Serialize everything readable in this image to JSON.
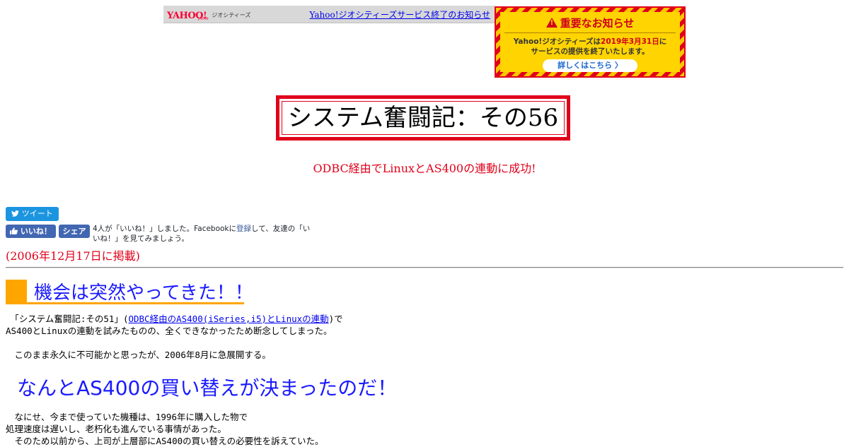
{
  "geocities_bar": {
    "logo_yahoo": "YAHOO!",
    "logo_japan": "JAPAN",
    "logo_geocities": "ジオシティーズ",
    "end_notice_link": "Yahoo!ジオシティーズサービス終了のお知らせ"
  },
  "notice_banner": {
    "title": "重要なお知らせ",
    "body_line1_pre": "Yahoo!ジオシティーズは",
    "body_line1_date": "2019年3月31日",
    "body_line1_post": "に",
    "body_line2": "サービスの提供を終了いたします。",
    "button_label": "詳しくはこちら 〉",
    "colors": {
      "red": "#e0001a",
      "yellow": "#ffd400"
    }
  },
  "page": {
    "title": "システム奮闘記：その56",
    "subtitle": "ODBC経由でLinuxとAS400の連動に成功!",
    "posted_date": "(2006年12月17日に掲載)"
  },
  "social": {
    "tweet_label": "ツイート",
    "like_label": "いいね！",
    "share_label": "シェア",
    "fb_text_pre": "4人が「いいね！」しました。Facebookに",
    "fb_login_link": "登録",
    "fb_text_line1_post": "して、友達の「い",
    "fb_text_line2": "いね！」を見てみましょう。"
  },
  "section1": {
    "heading": "機会は突然やってきた！！",
    "p1_pre": "　「システム奮闘記:その51」(",
    "p1_link": "ODBC経由のAS400(iSeries,i5)とLinuxの連動",
    "p1_post": ")で",
    "p1_line2": "AS400とLinuxの連動を試みたものの、全くできなかったため断念してしまった。",
    "p2": "　このまま永久に不可能かと思ったが、2006年8月に急展開する。",
    "emphasis": "なんとAS400の買い替えが決まったのだ！",
    "p3_line1": "　なにせ、今まで使っていた機種は、1996年に購入した物で",
    "p3_line2": "処理速度は遅いし、老朽化も進んでいる事情があった。",
    "p3_line3": "　そのため以前から、上司が上層部にAS400の買い替えの必要性を訴えていた。"
  }
}
